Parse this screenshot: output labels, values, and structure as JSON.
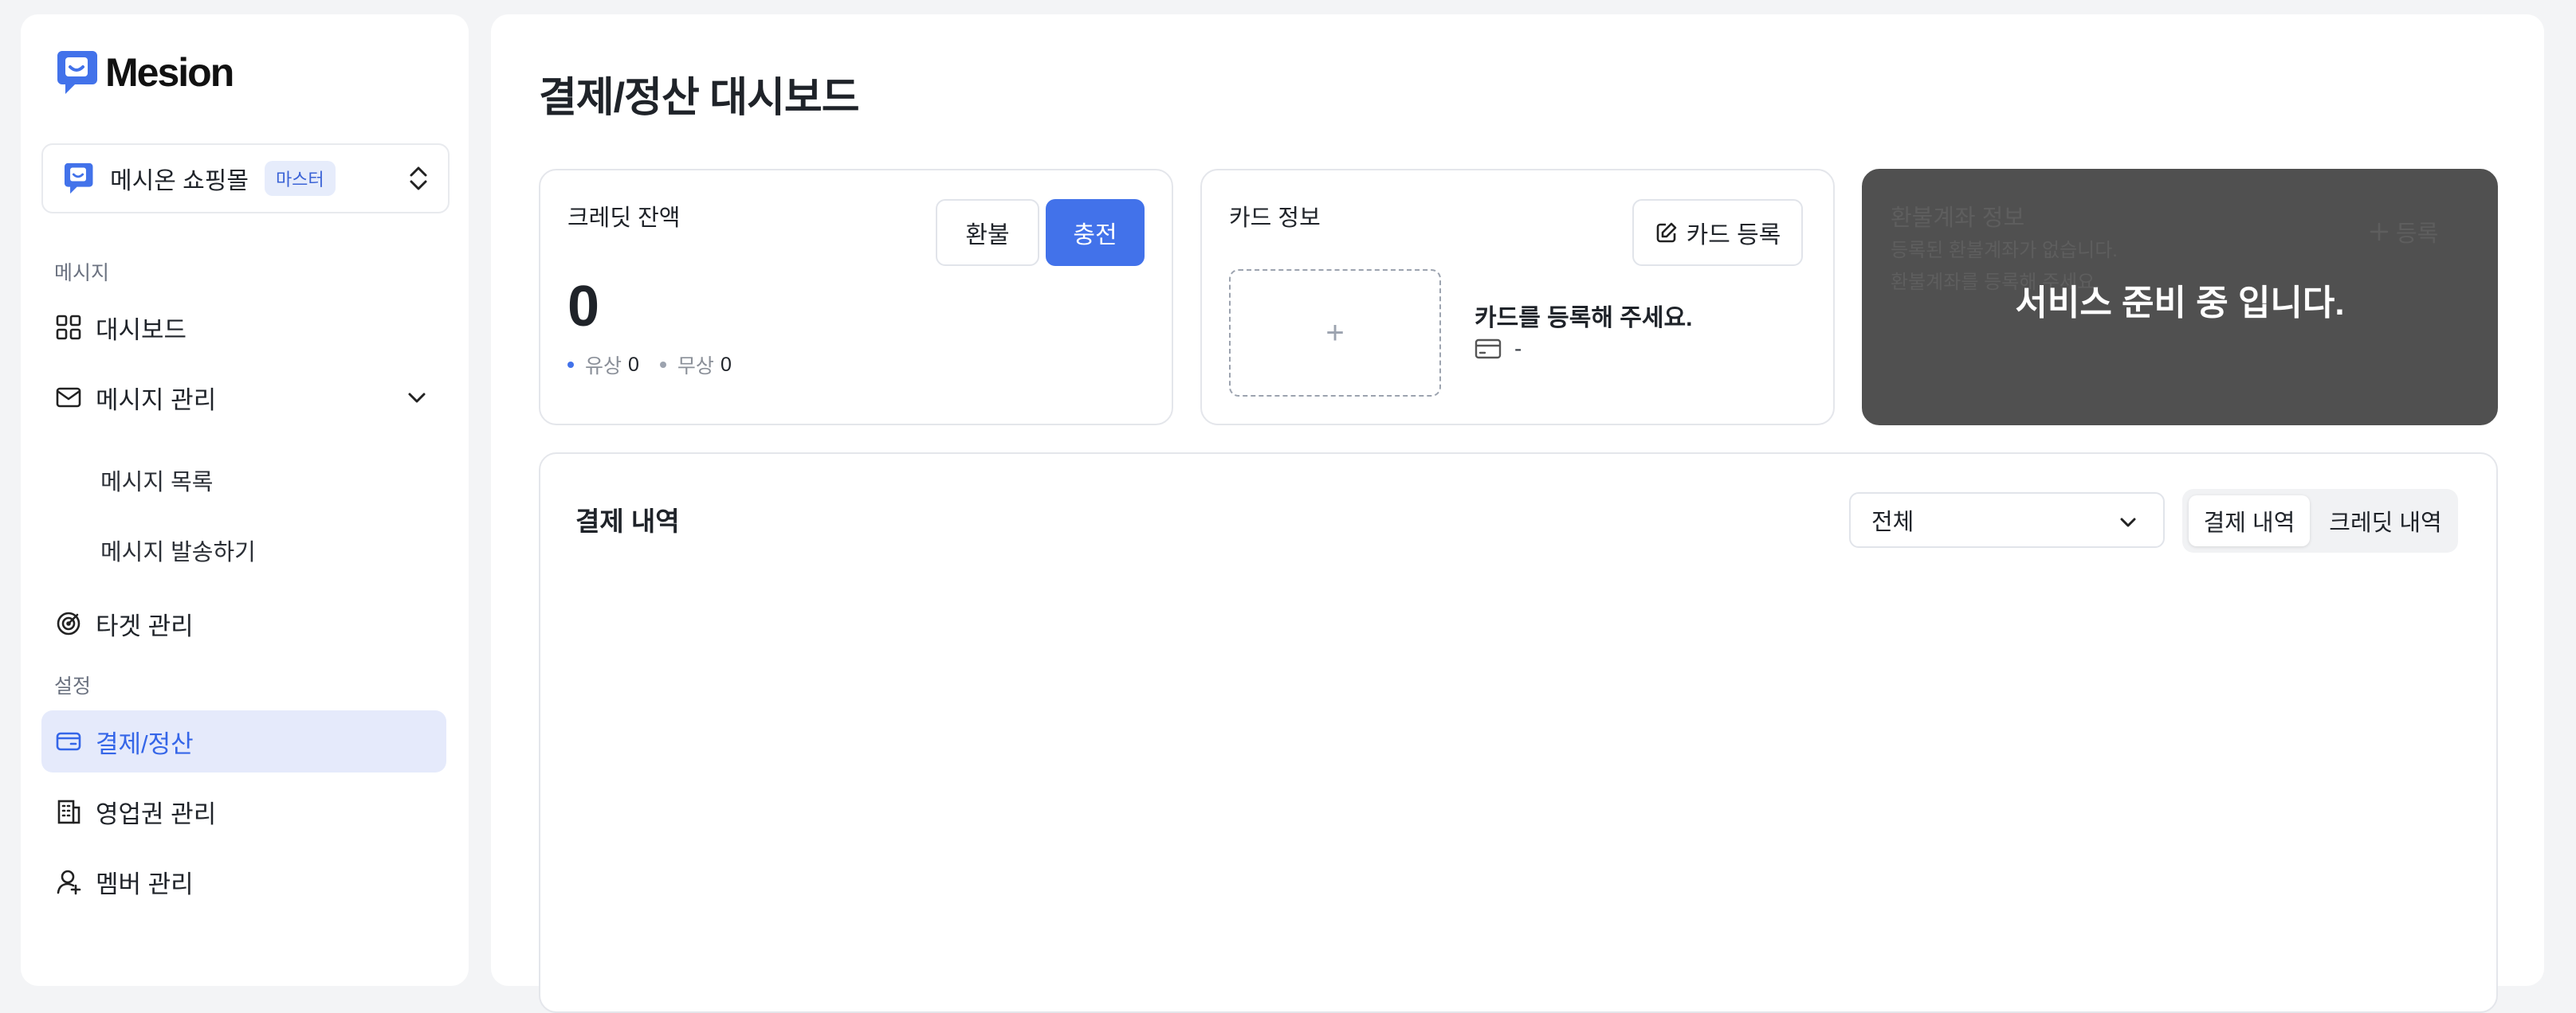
{
  "brand": {
    "name": "Mesion",
    "accent": "#4272ea"
  },
  "shop": {
    "name": "메시온 쇼핑몰",
    "badge": "마스터"
  },
  "sidebar": {
    "sections": [
      "메시지",
      "설정"
    ],
    "items": [
      {
        "label": "대시보드",
        "icon": "grid-icon"
      },
      {
        "label": "메시지 관리",
        "icon": "mail-icon"
      },
      {
        "label": "메시지 목록"
      },
      {
        "label": "메시지 발송하기"
      },
      {
        "label": "타겟 관리",
        "icon": "target-icon"
      },
      {
        "label": "결제/정산",
        "icon": "wallet-icon",
        "active": true
      },
      {
        "label": "영업권 관리",
        "icon": "building-icon"
      },
      {
        "label": "멤버 관리",
        "icon": "user-icon"
      }
    ]
  },
  "page": {
    "title": "결제/정산 대시보드"
  },
  "credit_card": {
    "title": "크레딧 잔액",
    "refund_label": "환불",
    "charge_label": "충전",
    "balance": "0",
    "paid_label": "유상",
    "paid_value": "0",
    "free_label": "무상",
    "free_value": "0"
  },
  "card_info": {
    "title": "카드 정보",
    "register_label": "카드 등록",
    "add_symbol": "+",
    "message": "카드를 등록해 주세요.",
    "card_number": "-"
  },
  "refund_account": {
    "title": "환불계좌 정보",
    "line1": "등록된 환불계좌가 없습니다.",
    "line2": "환불계좌를 등록해 주세요.",
    "register_label": "등록",
    "overlay": "서비스 준비 중 입니다."
  },
  "history": {
    "title": "결제 내역",
    "filter_value": "전체",
    "tabs": [
      "결제 내역",
      "크레딧 내역"
    ]
  }
}
